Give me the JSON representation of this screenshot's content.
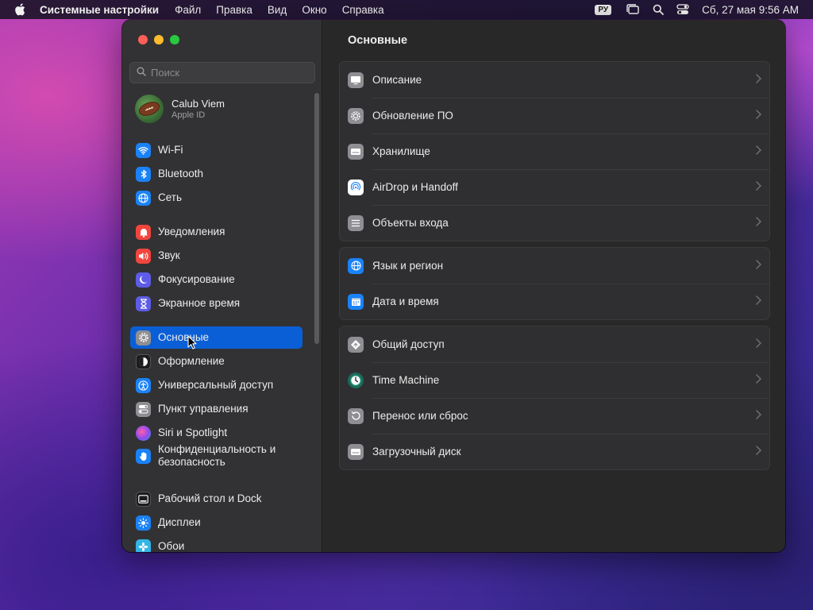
{
  "menubar": {
    "app_name": "Системные настройки",
    "menus": [
      "Файл",
      "Правка",
      "Вид",
      "Окно",
      "Справка"
    ],
    "lang": "РУ",
    "clock": "Сб, 27 мая  9:56 AM"
  },
  "search": {
    "placeholder": "Поиск"
  },
  "account": {
    "name": "Calub Viem",
    "sub": "Apple ID"
  },
  "sidebar": {
    "items": [
      {
        "label": "Wi-Fi",
        "icon": "wifi-icon",
        "color": "#1a82f7"
      },
      {
        "label": "Bluetooth",
        "icon": "bluetooth-icon",
        "color": "#1a82f7"
      },
      {
        "label": "Сеть",
        "icon": "globe-icon",
        "color": "#1a82f7"
      },
      {
        "label": "Уведомления",
        "icon": "bell-icon",
        "color": "#f2453d"
      },
      {
        "label": "Звук",
        "icon": "speaker-icon",
        "color": "#f2453d"
      },
      {
        "label": "Фокусирование",
        "icon": "moon-icon",
        "color": "#5e5ce6"
      },
      {
        "label": "Экранное время",
        "icon": "hourglass-icon",
        "color": "#5e5ce6"
      },
      {
        "label": "Основные",
        "icon": "gear-icon",
        "color": "#8e8e93"
      },
      {
        "label": "Оформление",
        "icon": "appearance-icon",
        "color": "#1c1c1e"
      },
      {
        "label": "Универсальный доступ",
        "icon": "accessibility-icon",
        "color": "#1a82f7"
      },
      {
        "label": "Пункт управления",
        "icon": "control-center-icon",
        "color": "#8e8e93"
      },
      {
        "label": "Siri и Spotlight",
        "icon": "siri-icon",
        "color": "#b64fd8"
      },
      {
        "label": "Конфиденциальность и безопасность",
        "icon": "hand-icon",
        "color": "#1a82f7"
      },
      {
        "label": "Рабочий стол и Dock",
        "icon": "dock-icon",
        "color": "#1c1c1e"
      },
      {
        "label": "Дисплеи",
        "icon": "sun-icon",
        "color": "#1a82f7"
      },
      {
        "label": "Обои",
        "icon": "wallpaper-icon",
        "color": "#33b5e5"
      }
    ]
  },
  "content": {
    "title": "Основные",
    "groups": [
      [
        {
          "label": "Описание",
          "icon": "about-icon"
        },
        {
          "label": "Обновление ПО",
          "icon": "software-update-icon"
        },
        {
          "label": "Хранилище",
          "icon": "storage-icon"
        },
        {
          "label": "AirDrop и Handoff",
          "icon": "airdrop-icon"
        },
        {
          "label": "Объекты входа",
          "icon": "login-items-icon"
        }
      ],
      [
        {
          "label": "Язык и регион",
          "icon": "language-globe-icon"
        },
        {
          "label": "Дата и время",
          "icon": "calendar-icon"
        }
      ],
      [
        {
          "label": "Общий доступ",
          "icon": "sharing-icon"
        },
        {
          "label": "Time Machine",
          "icon": "time-machine-icon"
        },
        {
          "label": "Перенос или сброс",
          "icon": "reset-icon"
        },
        {
          "label": "Загрузочный диск",
          "icon": "startup-disk-icon"
        }
      ]
    ]
  }
}
